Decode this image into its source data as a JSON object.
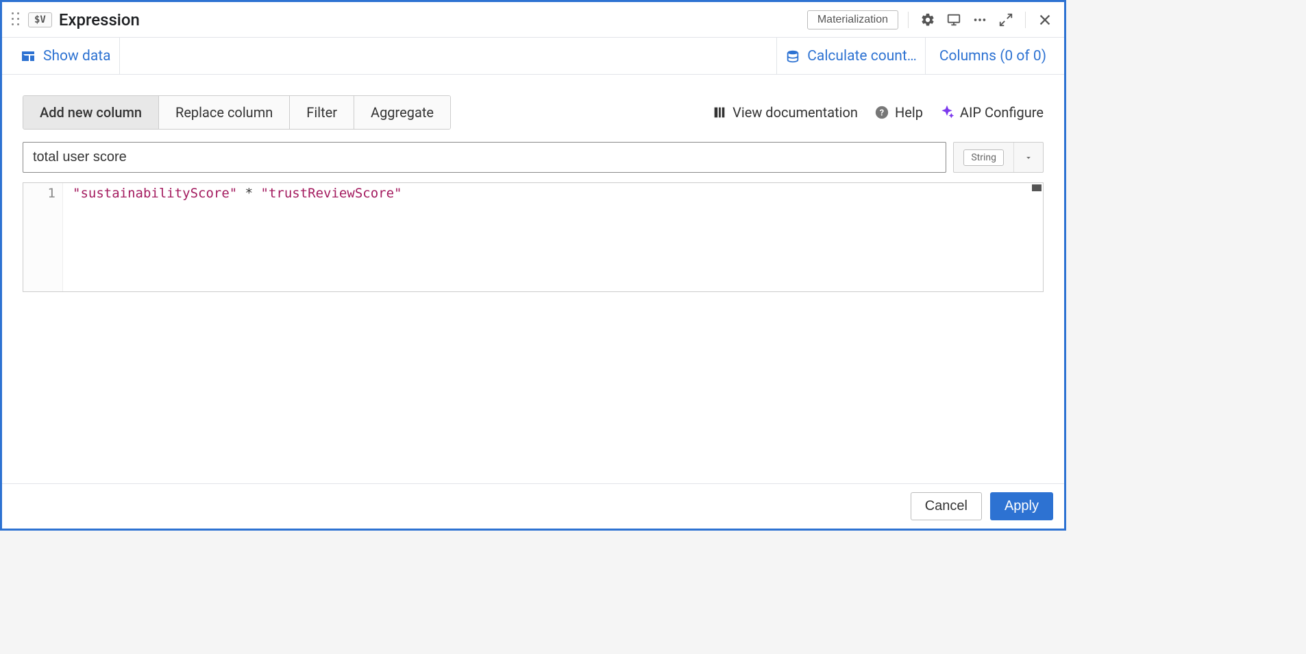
{
  "header": {
    "badge": "$V",
    "title": "Expression",
    "materialization": "Materialization"
  },
  "subheader": {
    "show_data": "Show data",
    "calculate": "Calculate count…",
    "columns": "Columns (0 of 0)"
  },
  "modes": {
    "add": "Add new column",
    "replace": "Replace column",
    "filter": "Filter",
    "aggregate": "Aggregate"
  },
  "links": {
    "view_docs": "View documentation",
    "help": "Help",
    "aip": "AIP Configure"
  },
  "form": {
    "col_name": "total user score",
    "type": "String"
  },
  "editor": {
    "line_no": "1",
    "token1": "\"sustainabilityScore\"",
    "token_op": " * ",
    "token2": "\"trustReviewScore\""
  },
  "footer": {
    "cancel": "Cancel",
    "apply": "Apply"
  }
}
